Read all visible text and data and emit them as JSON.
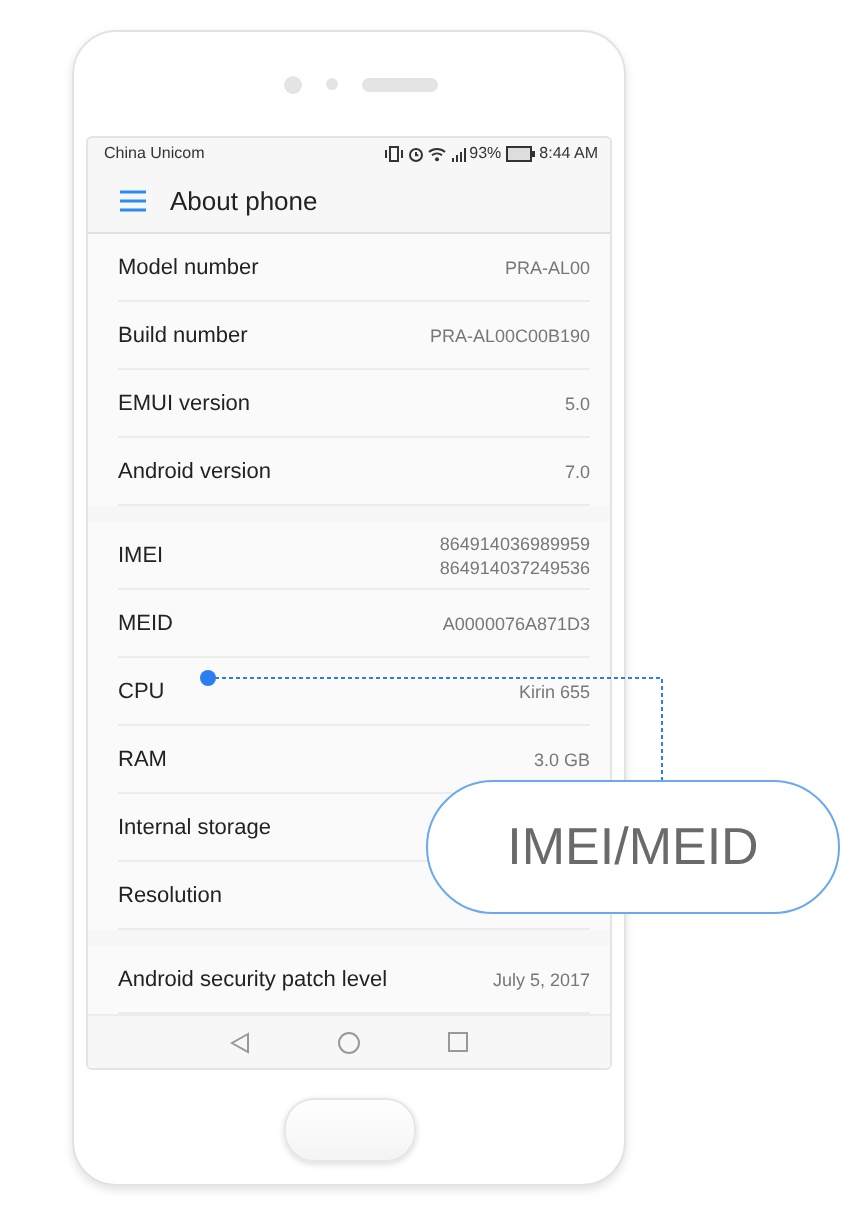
{
  "status_bar": {
    "carrier": "China Unicom",
    "battery": "93%",
    "time": "8:44 AM"
  },
  "app_bar": {
    "title": "About phone"
  },
  "sections": [
    {
      "rows": [
        {
          "label": "Model number",
          "values": [
            "PRA-AL00"
          ]
        },
        {
          "label": "Build number",
          "values": [
            "PRA-AL00C00B190"
          ]
        },
        {
          "label": "EMUI version",
          "values": [
            "5.0"
          ]
        },
        {
          "label": "Android version",
          "values": [
            "7.0"
          ]
        }
      ]
    },
    {
      "rows": [
        {
          "label": "IMEI",
          "values": [
            "864914036989959",
            "864914037249536"
          ]
        },
        {
          "label": "MEID",
          "values": [
            "A0000076A871D3"
          ]
        },
        {
          "label": "CPU",
          "values": [
            "Kirin 655"
          ]
        },
        {
          "label": "RAM",
          "values": [
            "3.0 GB"
          ]
        },
        {
          "label": "Internal storage",
          "values": []
        },
        {
          "label": "Resolution",
          "values": []
        }
      ]
    },
    {
      "rows": [
        {
          "label": "Android security patch level",
          "values": [
            "July 5, 2017"
          ]
        }
      ]
    }
  ],
  "callout": {
    "label": "IMEI/MEID"
  }
}
